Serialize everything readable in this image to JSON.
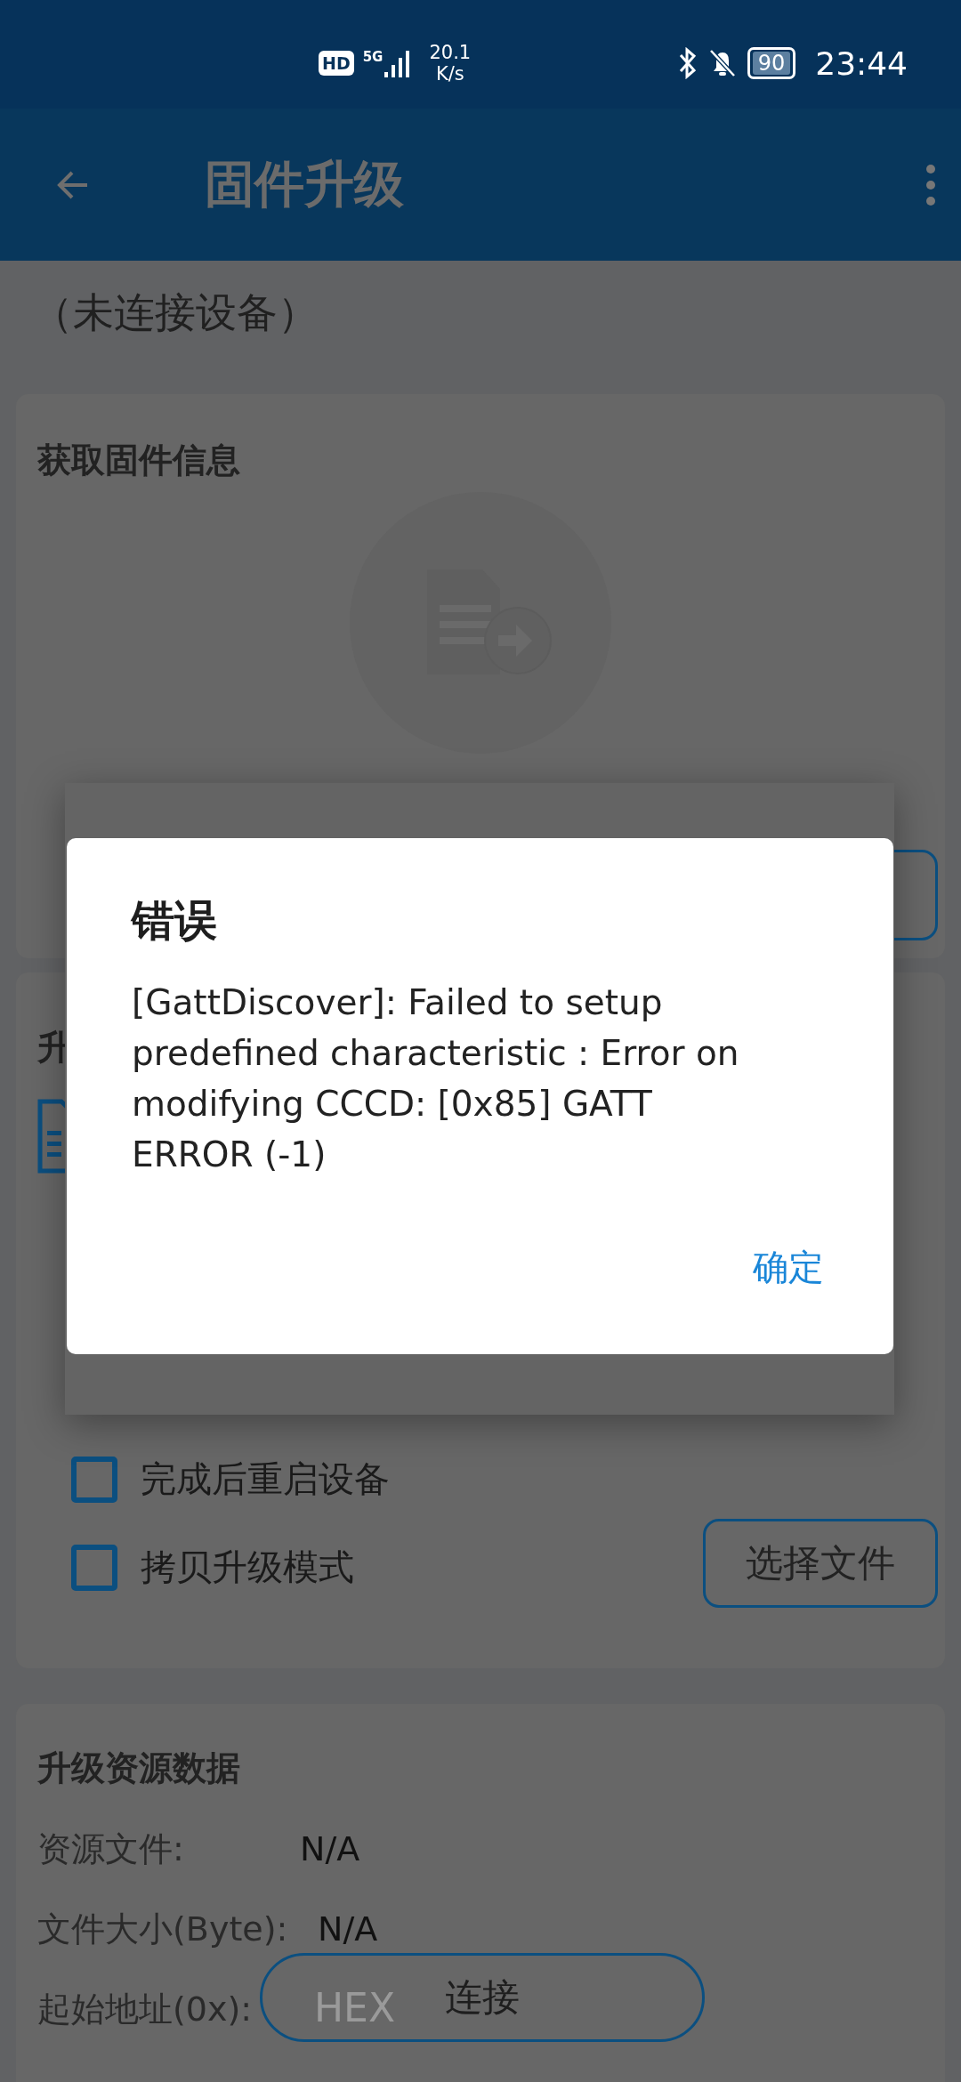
{
  "status_bar": {
    "hd": "HD",
    "network": "5G",
    "speed_value": "20.1",
    "speed_unit": "K/s",
    "battery": "90",
    "time": "23:44"
  },
  "app_bar": {
    "title": "固件升级"
  },
  "device_status": "（未连接设备）",
  "info_card": {
    "title": "获取固件信息"
  },
  "upgrade_card": {
    "title": "升",
    "options": [
      {
        "label": "完成后重启设备",
        "checked": false
      },
      {
        "label": "拷贝升级模式",
        "checked": false
      }
    ],
    "button": "选择文件"
  },
  "resource_card": {
    "title": "升级资源数据",
    "rows": [
      {
        "label": "资源文件:",
        "value": "N/A"
      },
      {
        "label": "文件大小(Byte):",
        "value": "N/A"
      },
      {
        "label": "起始地址(0x):",
        "placeholder": "HEX"
      }
    ]
  },
  "connect_dialog": {
    "kind": "dialog"
  },
  "floating_button": {
    "label": "连接"
  },
  "error_dialog": {
    "title": "错误",
    "message": "[GattDiscover]: Failed to setup predefined characteristic : Error on modifying CCCD: [0x85] GATT ERROR (-1)",
    "button": "确定"
  }
}
